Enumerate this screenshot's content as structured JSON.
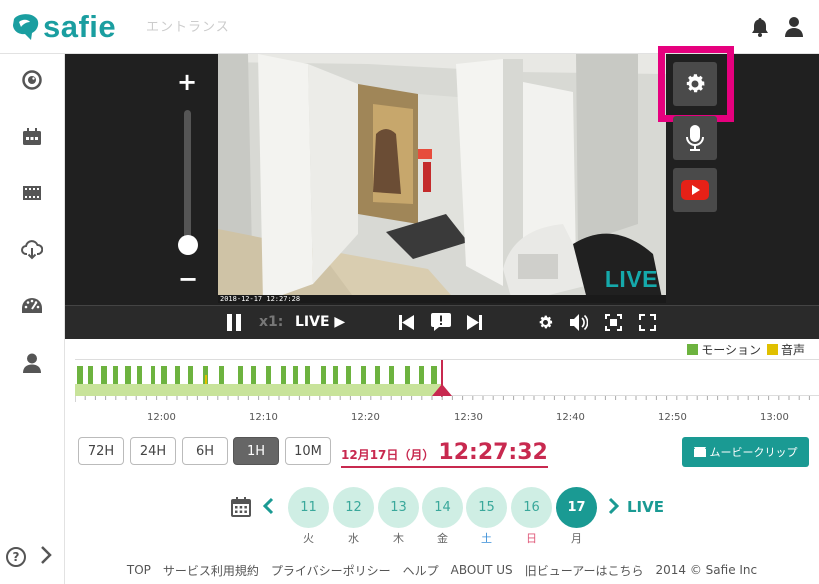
{
  "header": {
    "logo_text": "safie",
    "camera_name": "エントランス"
  },
  "icons": {
    "bell": "bell-icon",
    "user": "user-icon"
  },
  "sidebar": {
    "items": [
      "live-camera-icon",
      "calendar-icon",
      "film-icon",
      "cloud-download-icon",
      "dashboard-icon",
      "user-icon"
    ],
    "help_label": "?",
    "expand_label": "›"
  },
  "zoom": {
    "plus": "+",
    "minus": "−",
    "level": 0.0
  },
  "video": {
    "timestamp": "2018-12-17 12:27:28",
    "live_badge": "LIVE"
  },
  "controls": {
    "speed": "x1:",
    "live": "LIVE ▶"
  },
  "legend": {
    "motion": "モーション",
    "audio": "音声",
    "motion_color": "#6db33f",
    "audio_color": "#e0c000"
  },
  "timeline": {
    "ticks": [
      "12:00",
      "12:10",
      "12:20",
      "12:30",
      "12:40",
      "12:50",
      "13:00"
    ]
  },
  "ranges": [
    "72H",
    "24H",
    "6H",
    "1H",
    "10M"
  ],
  "active_range": "1H",
  "current_date": "12月17日（月）",
  "current_time": "12:27:32",
  "movie_clip_label": "ムービークリップ",
  "calendar": {
    "days": [
      {
        "num": "11",
        "dow": "火",
        "color": "#666"
      },
      {
        "num": "12",
        "dow": "水",
        "color": "#666"
      },
      {
        "num": "13",
        "dow": "木",
        "color": "#666"
      },
      {
        "num": "14",
        "dow": "金",
        "color": "#666"
      },
      {
        "num": "15",
        "dow": "土",
        "color": "#3b8fd8"
      },
      {
        "num": "16",
        "dow": "日",
        "color": "#e05a7a"
      },
      {
        "num": "17",
        "dow": "月",
        "color": "#666"
      }
    ],
    "live_label": "LIVE"
  },
  "footer": [
    "TOP",
    "サービス利用規約",
    "プライバシーポリシー",
    "ヘルプ",
    "ABOUT US",
    "旧ビューアーはこちら",
    "2014 © Safie Inc"
  ],
  "colors": {
    "accent": "#1a9ea0",
    "highlight": "#e6007e",
    "time_red": "#c8294f"
  }
}
